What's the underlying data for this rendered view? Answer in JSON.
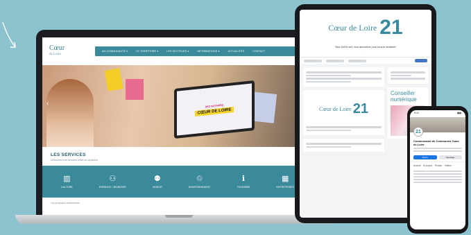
{
  "laptop": {
    "site": {
      "logo_main": "Cœur",
      "logo_sub": "de Loire",
      "nav_items": [
        "MA COMMUNAUTÉ ▾",
        "LE TERRITOIRE ▾",
        "LES SECTEURS ▾",
        "INFORMATIONS ▾",
        "ACTUALITÉS",
        "CONTACT"
      ],
      "hero_promo_top": "DES NOTAIRES",
      "hero_promo_main": "CŒUR DE LOIRE",
      "services_title": "LES SERVICES",
      "services_subtitle": "Découvrez nos services utiles au quotidien",
      "services": [
        {
          "icon": "culture-icon",
          "glyph": "▥",
          "label": "CULTURE"
        },
        {
          "icon": "enfance-icon",
          "glyph": "⚇",
          "label": "ENFANCE / JEUNESSE"
        },
        {
          "icon": "seniors-icon",
          "glyph": "⚉",
          "label": "SENIOR"
        },
        {
          "icon": "environnement-icon",
          "glyph": "♲",
          "label": "ENVIRONNEMENT"
        },
        {
          "icon": "tourisme-icon",
          "glyph": "ℹ",
          "label": "TOURISME"
        },
        {
          "icon": "entreprises-icon",
          "glyph": "▦",
          "label": "ENTREPRISES"
        }
      ],
      "footer_text": "Les prochains événements"
    }
  },
  "tablet": {
    "logo_main": "Cœur de Loire",
    "logo_number": "21",
    "slogan": "\"Des 100% vert, bon deuxième pour tous le territoire\"",
    "post_logo_main": "Cœur de Loire",
    "post_logo_number": "21",
    "conseiller_title": "Conseiller numérique"
  },
  "phone": {
    "time": "9:41",
    "avatar_number": "21",
    "page_name": "Communauté de Communes Cœur de Loire",
    "follow_label": "Suivre",
    "message_label": "Message",
    "tabs": [
      "Accueil",
      "À propos",
      "Photos",
      "Vidéos"
    ]
  }
}
